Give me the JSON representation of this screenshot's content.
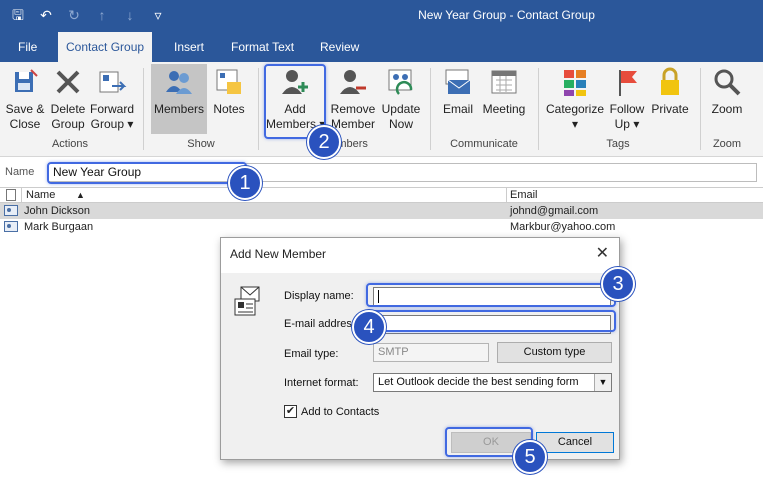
{
  "window": {
    "title": "New Year Group  -  Contact Group",
    "quick_access": [
      {
        "icon": "save-icon",
        "glyph": "🖫"
      },
      {
        "icon": "undo-icon",
        "glyph": "↶"
      },
      {
        "icon": "redo-icon",
        "glyph": "↻"
      },
      {
        "icon": "up-icon",
        "glyph": "↑"
      },
      {
        "icon": "down-icon",
        "glyph": "↓"
      },
      {
        "icon": "customize-icon",
        "glyph": "▿"
      }
    ]
  },
  "tabs": [
    "File",
    "Contact Group",
    "Insert",
    "Format Text",
    "Review"
  ],
  "ribbon": {
    "actions": {
      "save_close": "Save &\nClose",
      "delete_group": "Delete\nGroup",
      "forward_group": "Forward\nGroup ▾",
      "label": "Actions"
    },
    "show": {
      "members": "Members",
      "notes": "Notes",
      "label": "Show"
    },
    "members": {
      "add_members": "Add\nMembers ▾",
      "remove_member": "Remove\nMember",
      "update_now": "Update\nNow",
      "label": "Members"
    },
    "communicate": {
      "email": "Email",
      "meeting": "Meeting",
      "label": "Communicate"
    },
    "tags": {
      "categorize": "Categorize\n▾",
      "follow_up": "Follow\nUp ▾",
      "private": "Private",
      "label": "Tags"
    },
    "zoom": {
      "zoom": "Zoom",
      "label": "Zoom"
    }
  },
  "name_row": {
    "label": "Name",
    "value": "New Year Group"
  },
  "list": {
    "columns": [
      "Name",
      "Email"
    ],
    "rows": [
      {
        "name": "John Dickson",
        "email": "johnd@gmail.com"
      },
      {
        "name": "Mark Burgaan",
        "email": "Markbur@yahoo.com"
      }
    ]
  },
  "dialog": {
    "title": "Add New Member",
    "display_name_label": "Display name:",
    "display_name_value": "",
    "email_label": "E-mail addres",
    "email_value": "",
    "email_type_label": "Email type:",
    "email_type_value": "SMTP",
    "custom_type": "Custom type",
    "internet_format_label": "Internet format:",
    "internet_format_value": "Let Outlook decide the best sending form",
    "add_to_contacts": "Add to Contacts",
    "add_to_contacts_checked": true,
    "ok": "OK",
    "cancel": "Cancel"
  },
  "callouts": [
    "1",
    "2",
    "3",
    "4",
    "5"
  ],
  "colors": {
    "brand": "#2b579a",
    "highlight": "#4169e1",
    "badge": "#2a52be"
  }
}
